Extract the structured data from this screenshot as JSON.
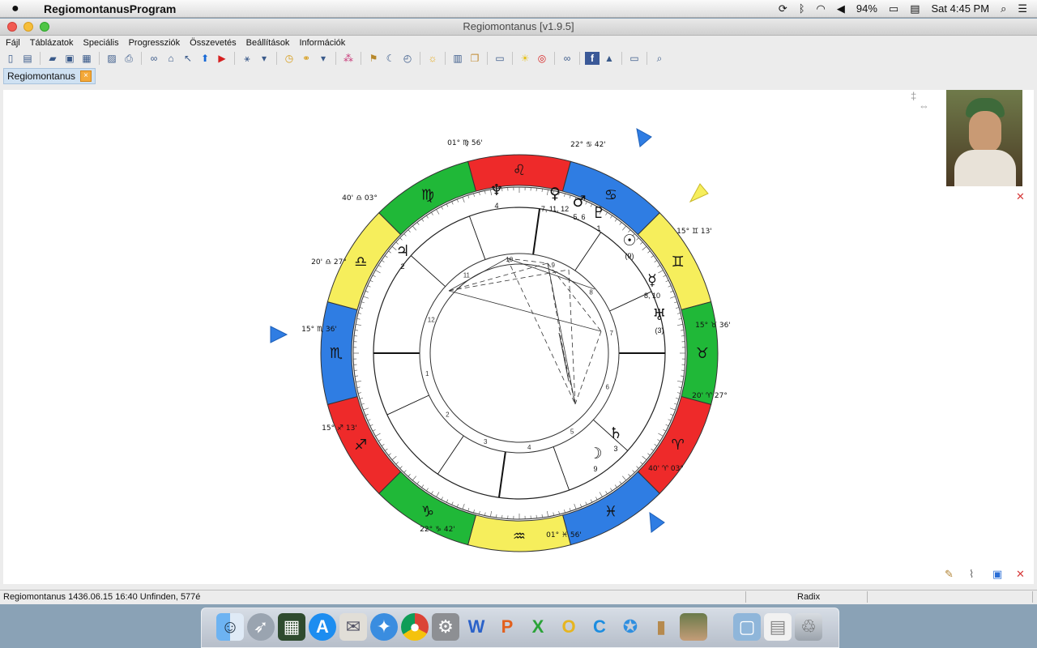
{
  "menubar": {
    "app_name": "RegiomontanusProgram",
    "battery": "94%",
    "clock": "Sat 4:45 PM"
  },
  "window": {
    "title": "Regiomontanus [v1.9.5]"
  },
  "menu": [
    "Fájl",
    "Táblázatok",
    "Speciális",
    "Progressziók",
    "Összevetés",
    "Beállítások",
    "Információk"
  ],
  "tab": {
    "label": "Regiomontanus"
  },
  "status": {
    "left": "Regiomontanus 1436.06.15 16:40 Unfinden,    577é",
    "center": "Radix"
  },
  "chart": {
    "signs": [
      {
        "name": "Leo",
        "glyph": "♌",
        "color": "#ee2a2a"
      },
      {
        "name": "Cancer",
        "glyph": "♋",
        "color": "#2f7de3"
      },
      {
        "name": "Gemini",
        "glyph": "♊",
        "color": "#f6ee5c"
      },
      {
        "name": "Taurus",
        "glyph": "♉",
        "color": "#20b838"
      },
      {
        "name": "Aries",
        "glyph": "♈",
        "color": "#ee2a2a"
      },
      {
        "name": "Pisces",
        "glyph": "♓",
        "color": "#2f7de3"
      },
      {
        "name": "Aquarius",
        "glyph": "♒",
        "color": "#f6ee5c"
      },
      {
        "name": "Capricorn",
        "glyph": "♑",
        "color": "#20b838"
      },
      {
        "name": "Sagittarius",
        "glyph": "♐",
        "color": "#ee2a2a"
      },
      {
        "name": "Scorpio",
        "glyph": "♏",
        "color": "#2f7de3"
      },
      {
        "name": "Libra",
        "glyph": "♎",
        "color": "#f6ee5c"
      },
      {
        "name": "Virgo",
        "glyph": "♍",
        "color": "#20b838"
      }
    ],
    "planets": [
      {
        "glyph": "♆",
        "label": "4"
      },
      {
        "glyph": "♀",
        "label": "7, 11, 12"
      },
      {
        "glyph": "♂",
        "label": "5, 6"
      },
      {
        "glyph": "♇",
        "label": "1"
      },
      {
        "glyph": "☉",
        "label": "(9)"
      },
      {
        "glyph": "♃",
        "label": "2"
      },
      {
        "glyph": "☿",
        "label": "8, 10"
      },
      {
        "glyph": "♅",
        "label": "(3)"
      },
      {
        "glyph": "♄",
        "label": "3"
      },
      {
        "glyph": "☽",
        "label": "9"
      }
    ],
    "cusp_labels": [
      {
        "deg": "01°",
        "sign": "♍",
        "min": "56'"
      },
      {
        "deg": "22°",
        "sign": "♋",
        "min": "42'"
      },
      {
        "deg": "15°",
        "sign": "♊",
        "min": "13'"
      },
      {
        "deg": "15°",
        "sign": "♉",
        "min": "36'"
      },
      {
        "deg": "20'",
        "sign": "♈",
        "min": "27°"
      },
      {
        "deg": "40'",
        "sign": "♈",
        "min": "03°"
      },
      {
        "deg": "01°",
        "sign": "♓",
        "min": "56'"
      },
      {
        "deg": "22°",
        "sign": "♑",
        "min": "42'"
      },
      {
        "deg": "15°",
        "sign": "♐",
        "min": "13'"
      },
      {
        "deg": "15°",
        "sign": "♏",
        "min": "36'"
      },
      {
        "deg": "20'",
        "sign": "♎",
        "min": "27°"
      },
      {
        "deg": "40'",
        "sign": "♎",
        "min": "03°"
      }
    ],
    "house_numbers": [
      "1",
      "2",
      "3",
      "4",
      "5",
      "6",
      "7",
      "8",
      "9",
      "10",
      "11",
      "12"
    ]
  }
}
